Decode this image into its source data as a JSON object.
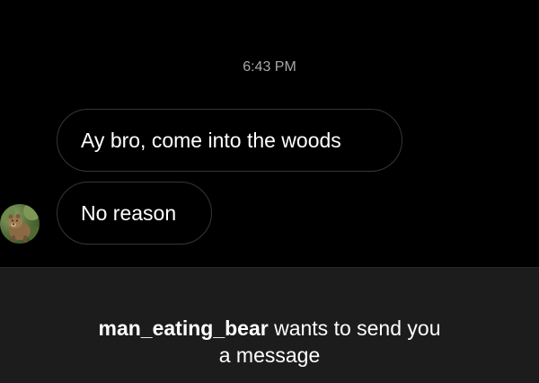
{
  "chat": {
    "timestamp": "6:43 PM",
    "messages": [
      {
        "text": "Ay bro, come into the woods"
      },
      {
        "text": "No reason"
      }
    ]
  },
  "sender": {
    "avatar_icon": "bear-avatar-icon"
  },
  "request": {
    "username": "man_eating_bear",
    "message_line1": " wants to send you",
    "message_line2": "a message"
  },
  "colors": {
    "background": "#000000",
    "bubble_border": "#363636",
    "timestamp": "#a8a8a8",
    "panel": "#1c1c1c",
    "text": "#ffffff"
  }
}
